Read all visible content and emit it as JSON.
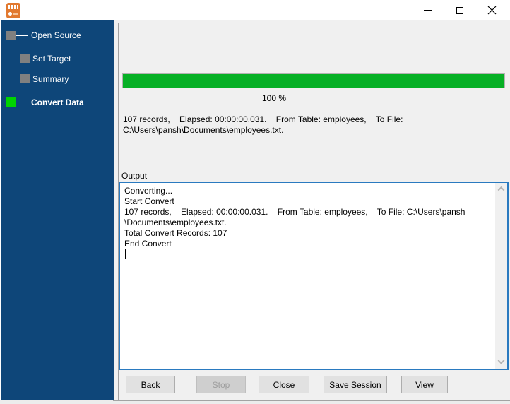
{
  "window": {
    "app_icon": "database-converter-app-icon",
    "controls": {
      "minimize": "minimize",
      "maximize": "maximize",
      "close": "close"
    }
  },
  "sidebar": {
    "steps": [
      {
        "label": "Open Source",
        "active": false
      },
      {
        "label": "Set Target",
        "active": false
      },
      {
        "label": "Summary",
        "active": false
      },
      {
        "label": "Convert Data",
        "active": true
      }
    ]
  },
  "main": {
    "progress": {
      "percent": 100,
      "label": "100 %"
    },
    "status": {
      "line1": "107 records,    Elapsed: 00:00:00.031.    From Table: employees,    To File:",
      "line2": "C:\\Users\\pansh\\Documents\\employees.txt."
    },
    "output": {
      "label": "Output",
      "text": "Converting...\nStart Convert\n107 records,    Elapsed: 00:00:00.031.    From Table: employees,    To File: C:\\Users\\pansh\n\\Documents\\employees.txt.\nTotal Convert Records: 107\nEnd Convert"
    },
    "buttons": [
      {
        "label": "Back",
        "enabled": true
      },
      {
        "label": "Stop",
        "enabled": false
      },
      {
        "label": "Close",
        "enabled": true
      },
      {
        "label": "Save Session",
        "enabled": true
      },
      {
        "label": "View",
        "enabled": true
      }
    ]
  },
  "colors": {
    "sidebar_blue": "#0e4679",
    "progress_green": "#06b025",
    "active_step_green": "#00d400",
    "inactive_step_gray": "#808080",
    "focused_border_blue": "#2a7ac0"
  }
}
